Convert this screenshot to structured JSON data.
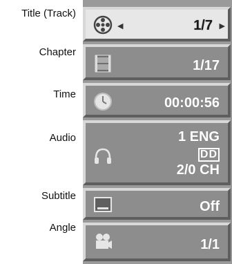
{
  "labels": {
    "title": "Title (Track)",
    "chapter": "Chapter",
    "time": "Time",
    "audio": "Audio",
    "subtitle": "Subtitle",
    "angle": "Angle"
  },
  "values": {
    "title": "1/7",
    "chapter": "1/17",
    "time": "00:00:56",
    "audio_line1": "1 ENG",
    "audio_line2": "DD",
    "audio_line3": "2/0 CH",
    "subtitle": "Off",
    "angle": "1/1"
  },
  "icons": {
    "title": "film-reel-icon",
    "chapter": "film-strip-icon",
    "time": "clock-icon",
    "audio": "headphones-icon",
    "subtitle": "subtitle-screen-icon",
    "angle": "camera-icon"
  },
  "colors": {
    "selected_row": "#e7e7e7",
    "row": "#8d8d8d",
    "value_text": "#ffffff"
  }
}
